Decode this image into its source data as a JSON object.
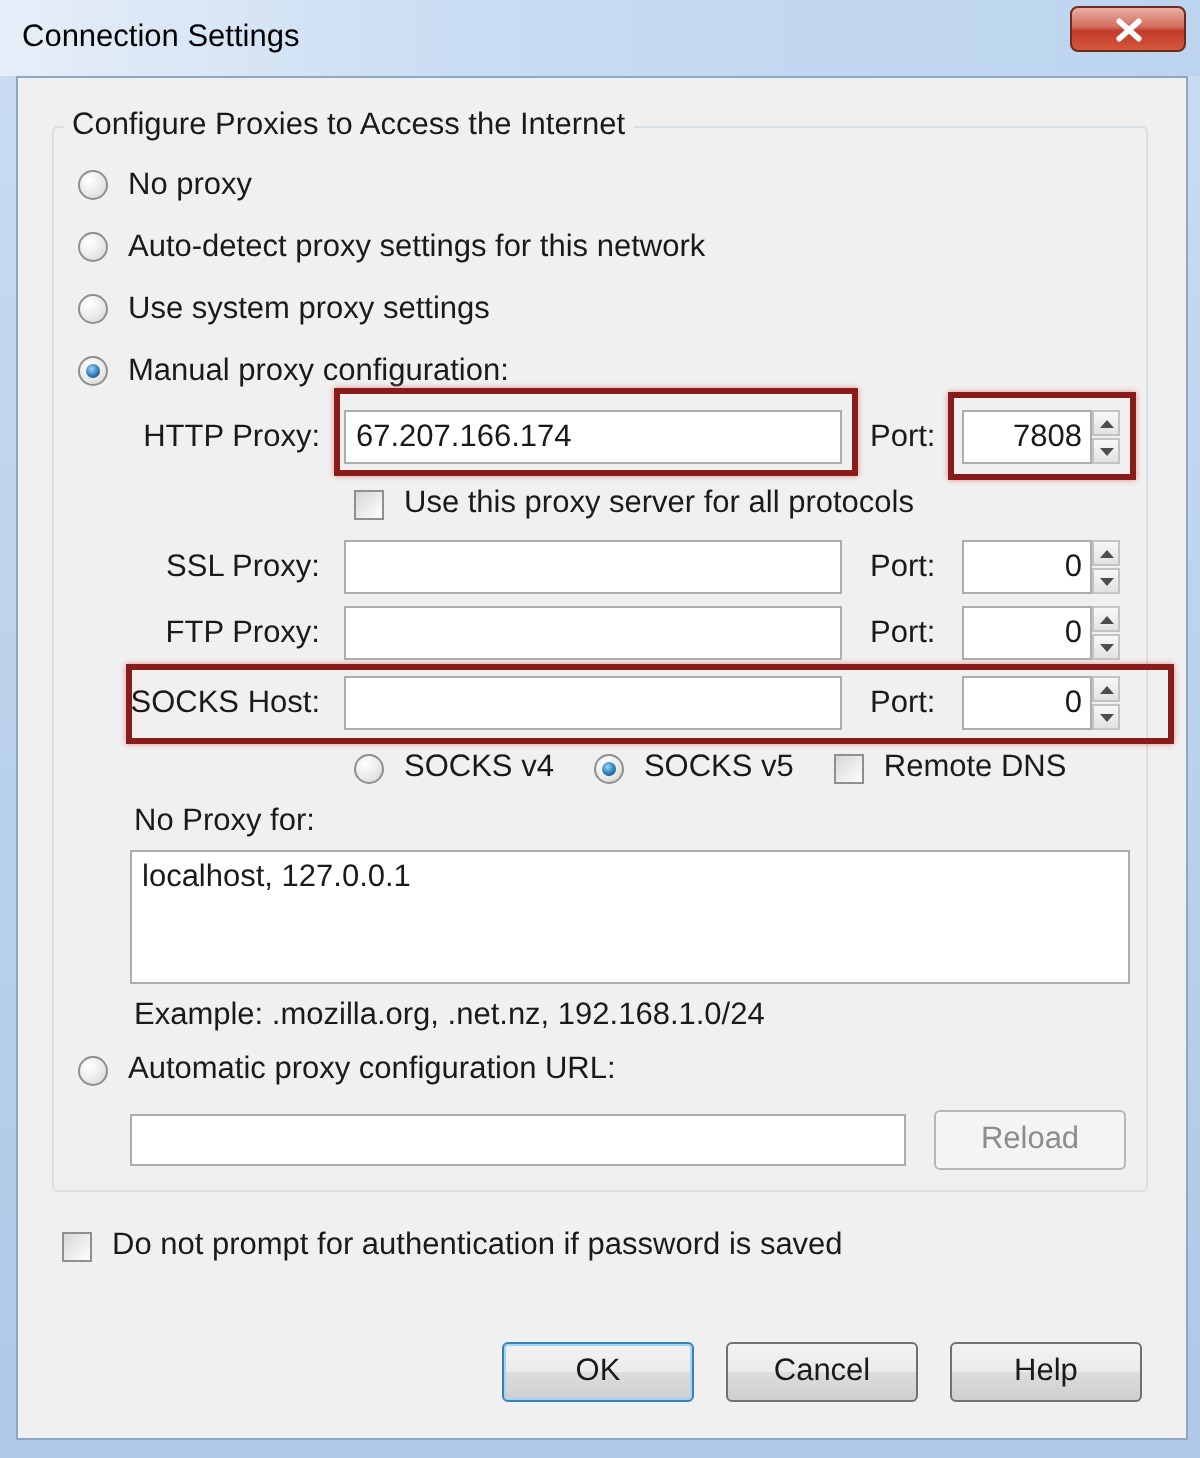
{
  "window": {
    "title": "Connection Settings"
  },
  "proxy_group": {
    "title": "Configure Proxies to Access the Internet"
  },
  "proxy_modes": [
    {
      "label": "No proxy",
      "selected": false
    },
    {
      "label": "Auto-detect proxy settings for this network",
      "selected": false
    },
    {
      "label": "Use system proxy settings",
      "selected": false
    },
    {
      "label": "Manual proxy configuration:",
      "selected": true
    }
  ],
  "http_proxy": {
    "label": "HTTP Proxy:",
    "value": "67.207.166.174",
    "port_label": "Port:",
    "port": "7808",
    "host_highlighted": true,
    "port_highlighted": true,
    "row_highlighted": false
  },
  "share_all_protocols": {
    "label": "Use this proxy server for all protocols",
    "checked": false
  },
  "other_proxies": [
    {
      "label": "SSL Proxy:",
      "port_label": "Port:",
      "port": "0",
      "host_highlighted": false,
      "port_highlighted": false,
      "row_highlighted": false
    },
    {
      "label": "FTP Proxy:",
      "port_label": "Port:",
      "port": "0",
      "host_highlighted": false,
      "port_highlighted": false,
      "row_highlighted": false
    },
    {
      "label": "SOCKS Host:",
      "port_label": "Port:",
      "port": "0",
      "host_highlighted": false,
      "port_highlighted": false,
      "row_highlighted": true
    }
  ],
  "socks_versions": [
    {
      "label": "SOCKS v4",
      "selected": false
    },
    {
      "label": "SOCKS v5",
      "selected": true
    }
  ],
  "remote_dns": {
    "label": "Remote DNS",
    "checked": false
  },
  "no_proxy": {
    "label": "No Proxy for:",
    "value": "localhost, 127.0.0.1",
    "example": "Example: .mozilla.org, .net.nz, 192.168.1.0/24"
  },
  "auto_config": {
    "label": "Automatic proxy configuration URL:",
    "selected": false,
    "reload_button": {
      "label": "Reload",
      "disabled": true
    }
  },
  "no_auth_prompt": {
    "label": "Do not prompt for authentication if password is saved",
    "checked": false
  },
  "buttons": [
    {
      "label": "OK",
      "default": true
    },
    {
      "label": "Cancel",
      "default": false
    },
    {
      "label": "Help",
      "default": false
    }
  ]
}
